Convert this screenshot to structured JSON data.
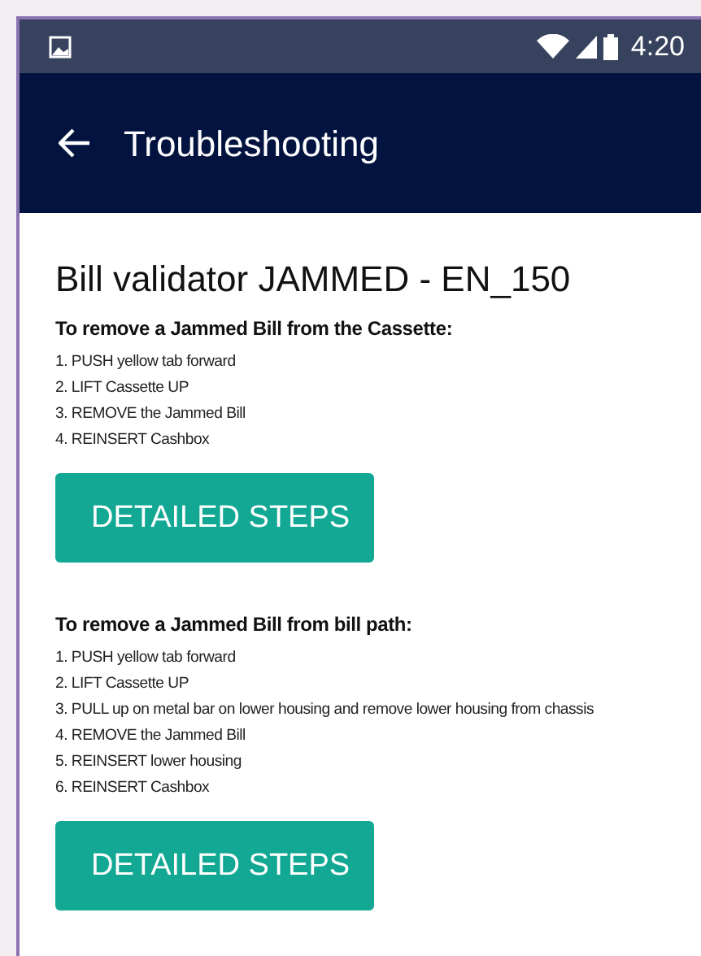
{
  "status_bar": {
    "time": "4:20"
  },
  "app_bar": {
    "title": "Troubleshooting"
  },
  "page_title": "Bill validator JAMMED - EN_150",
  "sections": [
    {
      "heading": "To remove a Jammed Bill from the Cassette:",
      "steps": [
        "1. PUSH yellow tab forward",
        "2. LIFT Cassette UP",
        "3. REMOVE the Jammed Bill",
        "4. REINSERT Cashbox"
      ],
      "button": "DETAILED STEPS"
    },
    {
      "heading": "To remove a Jammed Bill from bill path:",
      "steps": [
        "1. PUSH yellow tab forward",
        "2. LIFT Cassette UP",
        "3. PULL up on metal bar on lower housing and remove lower housing from chassis",
        "4. REMOVE the Jammed Bill",
        "5. REINSERT lower housing",
        "6. REINSERT Cashbox"
      ],
      "button": "DETAILED STEPS"
    }
  ]
}
